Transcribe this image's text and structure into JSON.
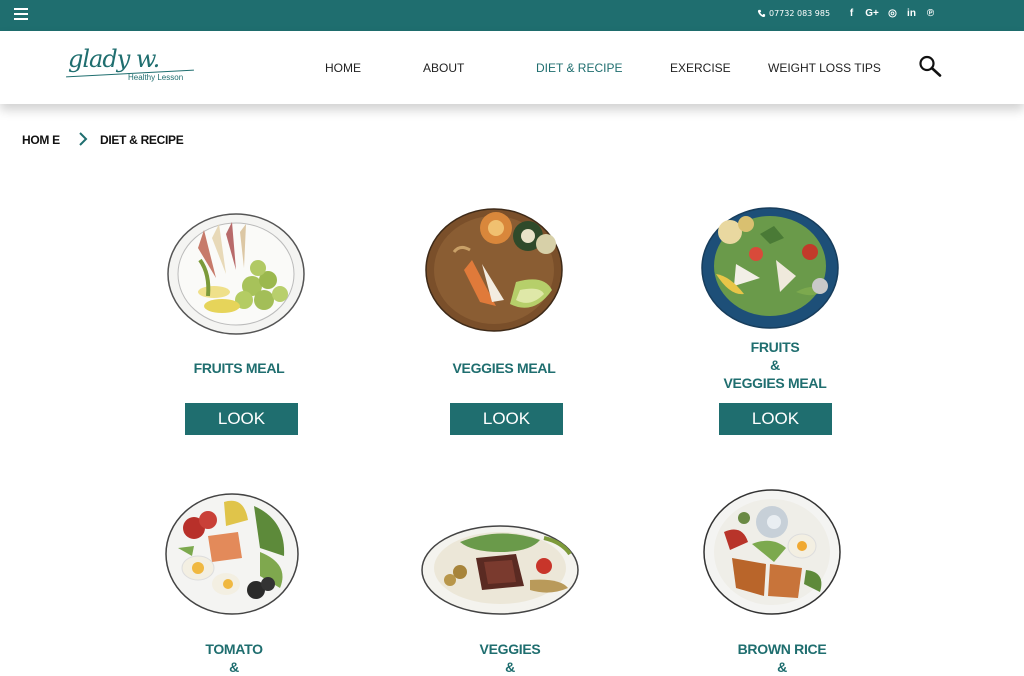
{
  "topbar": {
    "phone": "07732 083 985",
    "social_icons": [
      "facebook-icon",
      "google-plus-icon",
      "instagram-icon",
      "linkedin-icon",
      "pinterest-icon"
    ],
    "social_glyphs": [
      "f",
      "G+",
      "◎",
      "in",
      "℗"
    ]
  },
  "logo": {
    "script": "glady w.",
    "tagline": "Healthy Lesson"
  },
  "nav": {
    "items": [
      "HOME",
      "ABOUT",
      "DIET & RECIPE",
      "EXERCISE",
      "WEIGHT LOSS TIPS"
    ],
    "active": "DIET & RECIPE"
  },
  "breadcrumb": {
    "home": "HOM E",
    "current": "DIET & RECIPE"
  },
  "cards": [
    {
      "title": "FRUITS MEAL",
      "button": "LOOK"
    },
    {
      "title": "VEGGIES MEAL",
      "button": "LOOK"
    },
    {
      "title": "FRUITS\n&\nVEGGIES MEAL",
      "button": "LOOK"
    },
    {
      "title": "TOMATO\n&",
      "button": ""
    },
    {
      "title": "VEGGIES\n&",
      "button": ""
    },
    {
      "title": "BROWN RICE\n&",
      "button": ""
    }
  ],
  "colors": {
    "brand": "#1f6e6f",
    "text": "#222222"
  }
}
